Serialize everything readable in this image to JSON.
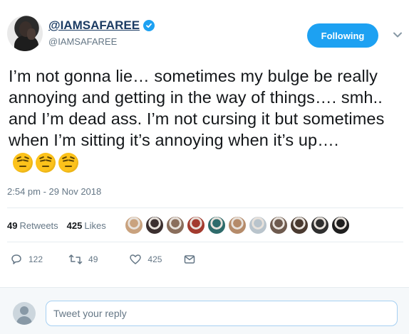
{
  "user": {
    "display_name": "@IAMSAFAREE",
    "handle": "@IAMSAFAREE",
    "verified": true
  },
  "follow_button": {
    "label": "Following"
  },
  "tweet": {
    "text": "I’m not gonna lie… sometimes my bulge be really annoying and getting in the way of things…. smh.. and I’m dead ass. I’m not cursing it but sometimes when I’m sitting it’s annoying when it’s up….",
    "emoji": [
      "pensive-face",
      "pensive-face",
      "pensive-face"
    ],
    "timestamp": "2:54 pm - 29 Nov 2018"
  },
  "stats": {
    "retweets_count": "49",
    "retweets_label": "Retweets",
    "likes_count": "425",
    "likes_label": "Likes"
  },
  "likers": [
    "#c9a27e",
    "#3b2f2f",
    "#8a6e5c",
    "#a33b2f",
    "#2e6b6b",
    "#b58b6a",
    "#b9c4cc",
    "#6e5a4e",
    "#4a3a30",
    "#2f2f2f",
    "#1f1f1f"
  ],
  "actions": {
    "reply_count": "122",
    "retweet_count": "49",
    "like_count": "425"
  },
  "reply": {
    "placeholder": "Tweet your reply"
  },
  "colors": {
    "accent": "#1da1f2",
    "muted": "#657786",
    "border": "#e6ecf0"
  }
}
